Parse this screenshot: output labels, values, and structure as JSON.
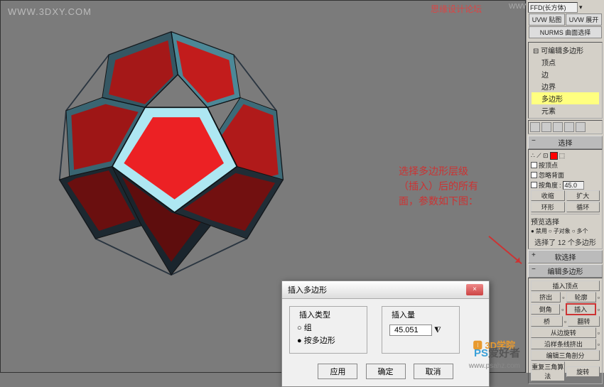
{
  "watermarks": {
    "top_left": "WWW.3DXY.COM",
    "top_right": "思缘设计论坛",
    "top_right_url": "WWW.MISSYUAN.COM",
    "bottom_right": "PS爱好者",
    "bottom_right_url": "www.psahz.com",
    "bottom_logo": "3D学院"
  },
  "annotation": "选择多边形层级（插入）后的所有面，参数如下图：",
  "dialog": {
    "title": "插入多边形",
    "close": "×",
    "type_group": "插入类型",
    "opt_group": "组",
    "opt_by_poly": "按多边形",
    "amount_group": "插入量",
    "amount_value": "45.051",
    "btn_apply": "应用",
    "btn_ok": "确定",
    "btn_cancel": "取消"
  },
  "rp": {
    "ffd_label": "FFD(长方体)",
    "btn_uvw_map": "UVW 贴图",
    "btn_uvw_unwrap": "UVW 展开",
    "btn_nurms": "NURMS 曲面选择",
    "tree_root": "可编辑多边形",
    "tree_vertex": "顶点",
    "tree_edge": "边",
    "tree_border": "边界",
    "tree_polygon": "多边形",
    "tree_element": "元素",
    "sel_header": "选择",
    "by_vertex": "按顶点",
    "ignore_back": "忽略背面",
    "by_angle": "按角度",
    "angle_val": "45.0",
    "shrink": "收缩",
    "grow": "扩大",
    "ring": "环形",
    "loop": "循环",
    "preview_sel": "预览选择",
    "preview_off": "禁用",
    "preview_sub": "子对象",
    "preview_multi": "多个",
    "sel_count": "选择了 12 个多边形",
    "soft_header": "软选择",
    "edit_poly_header": "编辑多边形",
    "insert_vertex": "插入顶点",
    "extrude": "挤出",
    "outline": "轮廓",
    "bevel": "倒角",
    "inset": "插入",
    "bridge": "桥",
    "flip": "翻转",
    "hinge": "从边旋转",
    "extrude_spline": "沿样条线挤出",
    "edit_tri": "编辑三角剖分",
    "retri": "重复三角算法",
    "turn": "旋转"
  },
  "chart_data": {
    "type": "3d-object",
    "description": "Truncated dodecahedron-like polyhedron rendered in viewport",
    "face_color": "#ec2124",
    "edge_color": "#5da6bb",
    "highlight_color": "#aee7f2",
    "dark_color": "#1c2830",
    "faces_selected": 12,
    "inset_amount": 45.051
  }
}
